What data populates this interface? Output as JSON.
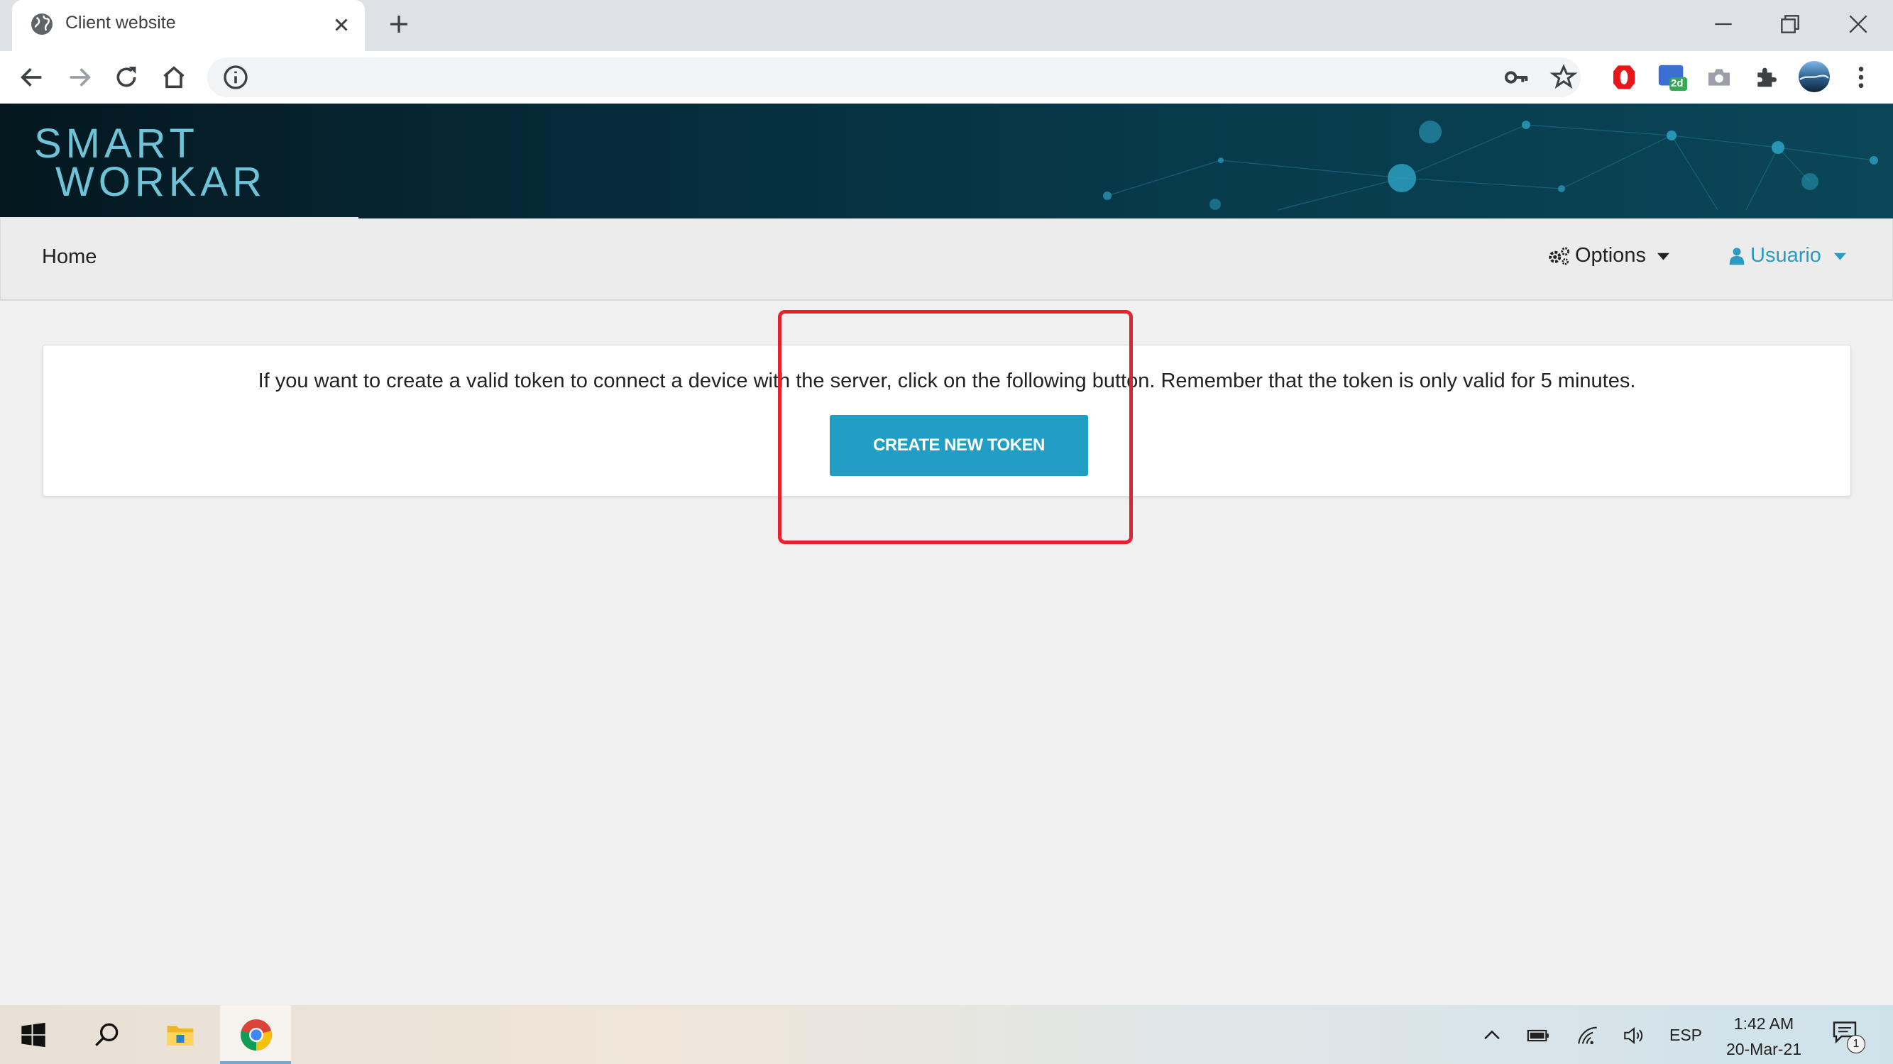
{
  "browser": {
    "tab_title": "Client website",
    "new_tab_icon": "plus-icon",
    "extension_badge": "2d"
  },
  "site": {
    "logo_line1": "SMART",
    "logo_line2": "WORKAR"
  },
  "navbar": {
    "home_label": "Home",
    "options_label": "Options",
    "user_label": "Usuario"
  },
  "content": {
    "message": "If you want to create a valid token to connect a device with the server, click on the following button. Remember that the token is only valid for 5 minutes.",
    "create_token_label": "CREATE NEW TOKEN"
  },
  "taskbar": {
    "language": "ESP",
    "time": "1:42 AM",
    "date": "20-Mar-21",
    "notification_count": "1"
  },
  "colors": {
    "accent": "#229dc3",
    "highlight": "#e3212f",
    "user_link": "#2a9bc2"
  }
}
